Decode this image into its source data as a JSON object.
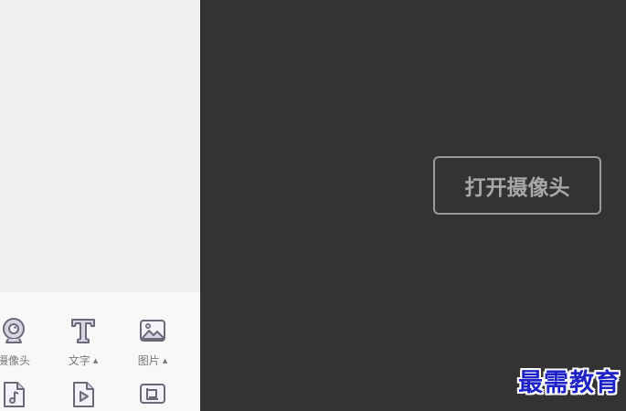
{
  "sources": {
    "camera_label": "摄像头",
    "text_label": "文字",
    "image_label": "图片",
    "caret": "▲",
    "icons": {
      "camera": "webcam-icon",
      "text": "text-T-icon",
      "image": "image-icon",
      "audio": "audio-file-icon",
      "video": "video-file-icon",
      "screen": "screen-capture-icon"
    }
  },
  "preview": {
    "open_camera_button": "打开摄像头"
  },
  "watermark": "最需教育",
  "colors": {
    "preview_bg": "#333333",
    "panel_bg": "#f0f0f0",
    "icon_stroke": "#6c6878",
    "icon_fill": "#d9d4e4",
    "watermark": "#1e23c8"
  }
}
